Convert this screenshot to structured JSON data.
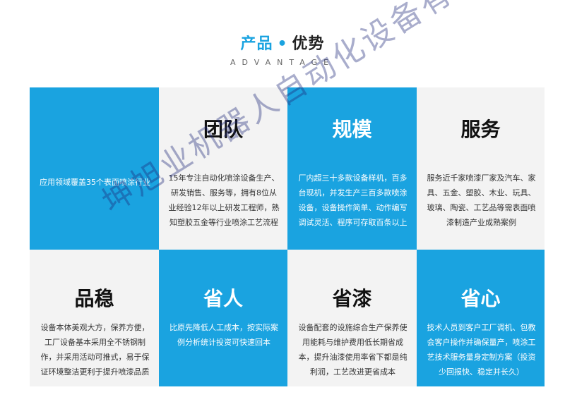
{
  "header": {
    "title_part1": "产品",
    "title_dot": "•",
    "title_part2": "优势",
    "subtitle": "ADVANTAGE"
  },
  "cards": [
    {
      "title": "",
      "text": "应用领域覆盖35个表面喷涂行业"
    },
    {
      "title": "团队",
      "text": "15年专注自动化喷涂设备生产、研发销售、服务等，拥有8位从业经验12年以上研发工程师，熟知塑胶五金等行业喷涂工艺流程"
    },
    {
      "title": "规模",
      "text": "厂内超三十多款设备样机，百多台现机，并发生产三百多款喷涂设备，设备操作简单、动作编写调试灵活、程序可存取百条以上"
    },
    {
      "title": "服务",
      "text": "服务近千家喷漆厂家及汽车、家具、五金、塑胶、木业、玩具、玻璃、陶瓷、工艺品等需表面喷漆制造产业成熟案例"
    },
    {
      "title": "品稳",
      "text": "设备本体美观大方，保养方便，工厂设备基本采用全不锈钢制作，并采用活动可推式，易于保证环境整洁更利于提升喷漆品质"
    },
    {
      "title": "省人",
      "text": "比原先降低人工成本，按实际案例分析统计投资可快速回本"
    },
    {
      "title": "省漆",
      "text": "设备配套的设施综合生产保养使用能耗与维护费用低长期省成本，提升油漆使用率省下都是纯利润，工艺改进更省成本"
    },
    {
      "title": "省心",
      "text": "技术人员到客户工厂调机、包教会客户操作并确保量产，喷涂工艺技术服务量身定制方案（投资少回报快、稳定并长久）"
    }
  ],
  "watermark": "坤旭业机器人自动化设备有限公司",
  "colors": {
    "accent": "#1aa3e0",
    "card_gray": "#f3f3f3"
  }
}
